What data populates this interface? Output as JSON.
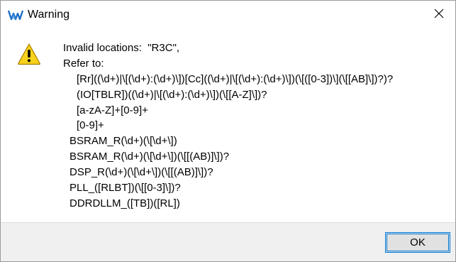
{
  "window": {
    "title": "Warning",
    "app_icon": "gowin-logo-icon",
    "close_icon": "close-icon"
  },
  "message": {
    "icon": "warning-triangle-icon",
    "lines": [
      "Invalid locations:  \"R3C\",",
      "Refer to:",
      "[Rr]((\\d+)|\\[(\\d+):(\\d+)\\])[Cc]((\\d+)|\\[(\\d+):(\\d+)\\])(\\[([0-3])\\](\\[[AB]\\])?)?",
      "(IO[TBLR])((\\d+)|\\[(\\d+):(\\d+)\\])(\\[[A-Z]\\])?",
      "[a-zA-Z]+[0-9]+",
      "[0-9]+",
      "BSRAM_R(\\d+)(\\[\\d+\\])",
      "BSRAM_R(\\d+)(\\[\\d+\\])(\\[[(AB)]\\])?",
      "DSP_R(\\d+)(\\[\\d+\\])(\\[[(AB)]\\])?",
      "PLL_([RLBT])(\\[[0-3]\\])?",
      "DDRDLLM_([TB])([RL])"
    ]
  },
  "buttons": {
    "ok_label": "OK"
  },
  "colors": {
    "warning_yellow": "#f8d21b",
    "focus_blue": "#0078d7",
    "logo_blue": "#1e6fc8"
  }
}
